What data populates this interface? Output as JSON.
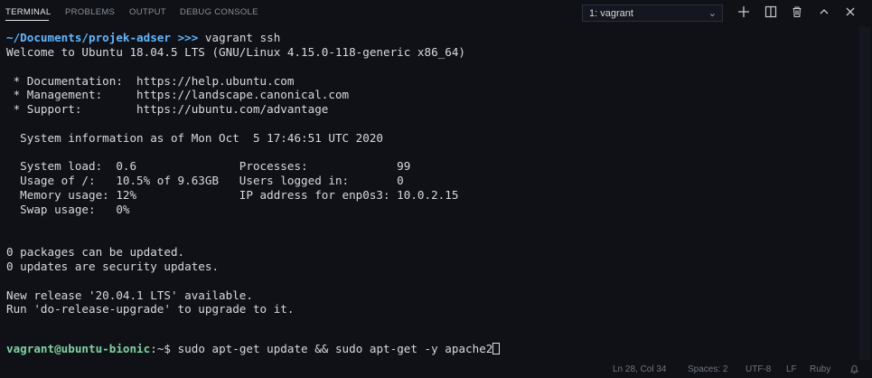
{
  "tabs": {
    "terminal": "TERMINAL",
    "problems": "PROBLEMS",
    "output": "OUTPUT",
    "debug": "DEBUG CONSOLE"
  },
  "terminal_select": {
    "value": "1: vagrant"
  },
  "icons": [
    "chevron-down-icon",
    "plus-icon",
    "split-icon",
    "trash-icon",
    "chevron-up-icon",
    "close-icon"
  ],
  "terminal": {
    "prompt_path": "~/Documents/projek-adser",
    "prompt_arrows": " >>> ",
    "prompt_cmd": "vagrant ssh",
    "lines": [
      "Welcome to Ubuntu 18.04.5 LTS (GNU/Linux 4.15.0-118-generic x86_64)",
      "",
      " * Documentation:  https://help.ubuntu.com",
      " * Management:     https://landscape.canonical.com",
      " * Support:        https://ubuntu.com/advantage",
      "",
      "  System information as of Mon Oct  5 17:46:51 UTC 2020",
      "",
      "  System load:  0.6               Processes:             99",
      "  Usage of /:   10.5% of 9.63GB   Users logged in:       0",
      "  Memory usage: 12%               IP address for enp0s3: 10.0.2.15",
      "  Swap usage:   0%",
      "",
      "",
      "0 packages can be updated.",
      "0 updates are security updates.",
      "",
      "New release '20.04.1 LTS' available.",
      "Run 'do-release-upgrade' to upgrade to it.",
      "",
      ""
    ],
    "final_user": "vagrant@ubuntu-bionic",
    "final_sep": ":~$ ",
    "final_cmd": "sudo apt-get update && sudo apt-get -y apache2"
  },
  "status": {
    "position": "Ln 28, Col 34",
    "spaces": "Spaces: 2",
    "encoding": "UTF-8",
    "eol": "LF",
    "language": "Ruby"
  },
  "colors": {
    "background": "#0f1117",
    "path": "#5fb7ff",
    "host": "#7fd1a0",
    "text": "#d7dae0"
  }
}
